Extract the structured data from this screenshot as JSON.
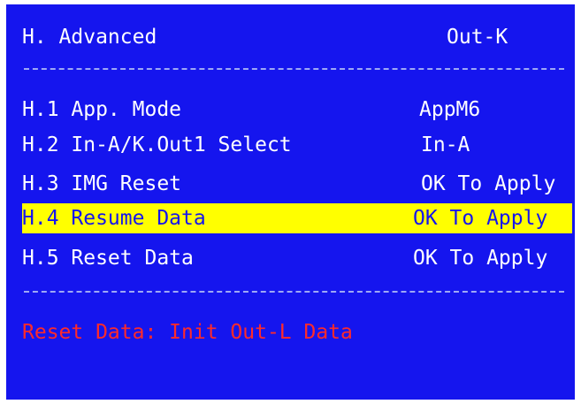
{
  "header": {
    "title": "H. Advanced",
    "mode": "Out-K"
  },
  "divider_text": "----------------------------------------",
  "menu": {
    "items": [
      {
        "label": "H.1 App. Mode",
        "value": "AppM6"
      },
      {
        "label": "H.2 In-A/K.Out1 Select",
        "value": "In-A"
      },
      {
        "label": "H.3 IMG Reset",
        "value": "OK To Apply"
      },
      {
        "label": "H.4 Resume Data",
        "value": "OK To Apply"
      },
      {
        "label": "H.5 Reset Data",
        "value": "OK To Apply"
      }
    ],
    "selected_index": 3
  },
  "status": {
    "message": "Reset Data: Init Out-L Data"
  },
  "colors": {
    "background": "#1515ee",
    "text": "#ffffff",
    "highlight": "#ffff00",
    "status": "#ff2a2a"
  }
}
